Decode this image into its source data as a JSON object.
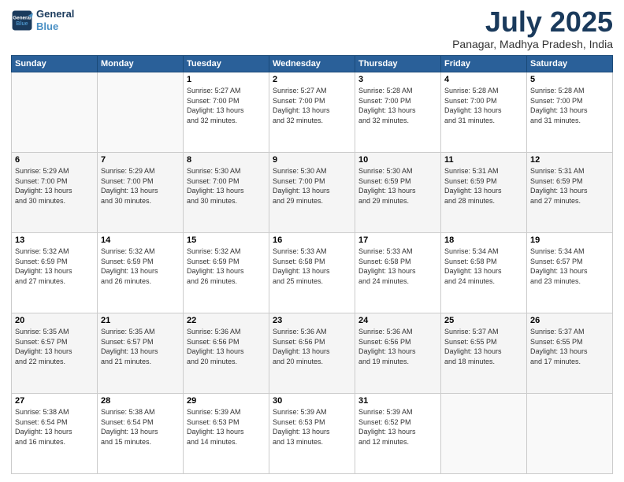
{
  "header": {
    "logo_line1": "General",
    "logo_line2": "Blue",
    "month": "July 2025",
    "location": "Panagar, Madhya Pradesh, India"
  },
  "weekdays": [
    "Sunday",
    "Monday",
    "Tuesday",
    "Wednesday",
    "Thursday",
    "Friday",
    "Saturday"
  ],
  "weeks": [
    [
      {
        "day": "",
        "info": ""
      },
      {
        "day": "",
        "info": ""
      },
      {
        "day": "1",
        "info": "Sunrise: 5:27 AM\nSunset: 7:00 PM\nDaylight: 13 hours\nand 32 minutes."
      },
      {
        "day": "2",
        "info": "Sunrise: 5:27 AM\nSunset: 7:00 PM\nDaylight: 13 hours\nand 32 minutes."
      },
      {
        "day": "3",
        "info": "Sunrise: 5:28 AM\nSunset: 7:00 PM\nDaylight: 13 hours\nand 32 minutes."
      },
      {
        "day": "4",
        "info": "Sunrise: 5:28 AM\nSunset: 7:00 PM\nDaylight: 13 hours\nand 31 minutes."
      },
      {
        "day": "5",
        "info": "Sunrise: 5:28 AM\nSunset: 7:00 PM\nDaylight: 13 hours\nand 31 minutes."
      }
    ],
    [
      {
        "day": "6",
        "info": "Sunrise: 5:29 AM\nSunset: 7:00 PM\nDaylight: 13 hours\nand 30 minutes."
      },
      {
        "day": "7",
        "info": "Sunrise: 5:29 AM\nSunset: 7:00 PM\nDaylight: 13 hours\nand 30 minutes."
      },
      {
        "day": "8",
        "info": "Sunrise: 5:30 AM\nSunset: 7:00 PM\nDaylight: 13 hours\nand 30 minutes."
      },
      {
        "day": "9",
        "info": "Sunrise: 5:30 AM\nSunset: 7:00 PM\nDaylight: 13 hours\nand 29 minutes."
      },
      {
        "day": "10",
        "info": "Sunrise: 5:30 AM\nSunset: 6:59 PM\nDaylight: 13 hours\nand 29 minutes."
      },
      {
        "day": "11",
        "info": "Sunrise: 5:31 AM\nSunset: 6:59 PM\nDaylight: 13 hours\nand 28 minutes."
      },
      {
        "day": "12",
        "info": "Sunrise: 5:31 AM\nSunset: 6:59 PM\nDaylight: 13 hours\nand 27 minutes."
      }
    ],
    [
      {
        "day": "13",
        "info": "Sunrise: 5:32 AM\nSunset: 6:59 PM\nDaylight: 13 hours\nand 27 minutes."
      },
      {
        "day": "14",
        "info": "Sunrise: 5:32 AM\nSunset: 6:59 PM\nDaylight: 13 hours\nand 26 minutes."
      },
      {
        "day": "15",
        "info": "Sunrise: 5:32 AM\nSunset: 6:59 PM\nDaylight: 13 hours\nand 26 minutes."
      },
      {
        "day": "16",
        "info": "Sunrise: 5:33 AM\nSunset: 6:58 PM\nDaylight: 13 hours\nand 25 minutes."
      },
      {
        "day": "17",
        "info": "Sunrise: 5:33 AM\nSunset: 6:58 PM\nDaylight: 13 hours\nand 24 minutes."
      },
      {
        "day": "18",
        "info": "Sunrise: 5:34 AM\nSunset: 6:58 PM\nDaylight: 13 hours\nand 24 minutes."
      },
      {
        "day": "19",
        "info": "Sunrise: 5:34 AM\nSunset: 6:57 PM\nDaylight: 13 hours\nand 23 minutes."
      }
    ],
    [
      {
        "day": "20",
        "info": "Sunrise: 5:35 AM\nSunset: 6:57 PM\nDaylight: 13 hours\nand 22 minutes."
      },
      {
        "day": "21",
        "info": "Sunrise: 5:35 AM\nSunset: 6:57 PM\nDaylight: 13 hours\nand 21 minutes."
      },
      {
        "day": "22",
        "info": "Sunrise: 5:36 AM\nSunset: 6:56 PM\nDaylight: 13 hours\nand 20 minutes."
      },
      {
        "day": "23",
        "info": "Sunrise: 5:36 AM\nSunset: 6:56 PM\nDaylight: 13 hours\nand 20 minutes."
      },
      {
        "day": "24",
        "info": "Sunrise: 5:36 AM\nSunset: 6:56 PM\nDaylight: 13 hours\nand 19 minutes."
      },
      {
        "day": "25",
        "info": "Sunrise: 5:37 AM\nSunset: 6:55 PM\nDaylight: 13 hours\nand 18 minutes."
      },
      {
        "day": "26",
        "info": "Sunrise: 5:37 AM\nSunset: 6:55 PM\nDaylight: 13 hours\nand 17 minutes."
      }
    ],
    [
      {
        "day": "27",
        "info": "Sunrise: 5:38 AM\nSunset: 6:54 PM\nDaylight: 13 hours\nand 16 minutes."
      },
      {
        "day": "28",
        "info": "Sunrise: 5:38 AM\nSunset: 6:54 PM\nDaylight: 13 hours\nand 15 minutes."
      },
      {
        "day": "29",
        "info": "Sunrise: 5:39 AM\nSunset: 6:53 PM\nDaylight: 13 hours\nand 14 minutes."
      },
      {
        "day": "30",
        "info": "Sunrise: 5:39 AM\nSunset: 6:53 PM\nDaylight: 13 hours\nand 13 minutes."
      },
      {
        "day": "31",
        "info": "Sunrise: 5:39 AM\nSunset: 6:52 PM\nDaylight: 13 hours\nand 12 minutes."
      },
      {
        "day": "",
        "info": ""
      },
      {
        "day": "",
        "info": ""
      }
    ]
  ]
}
